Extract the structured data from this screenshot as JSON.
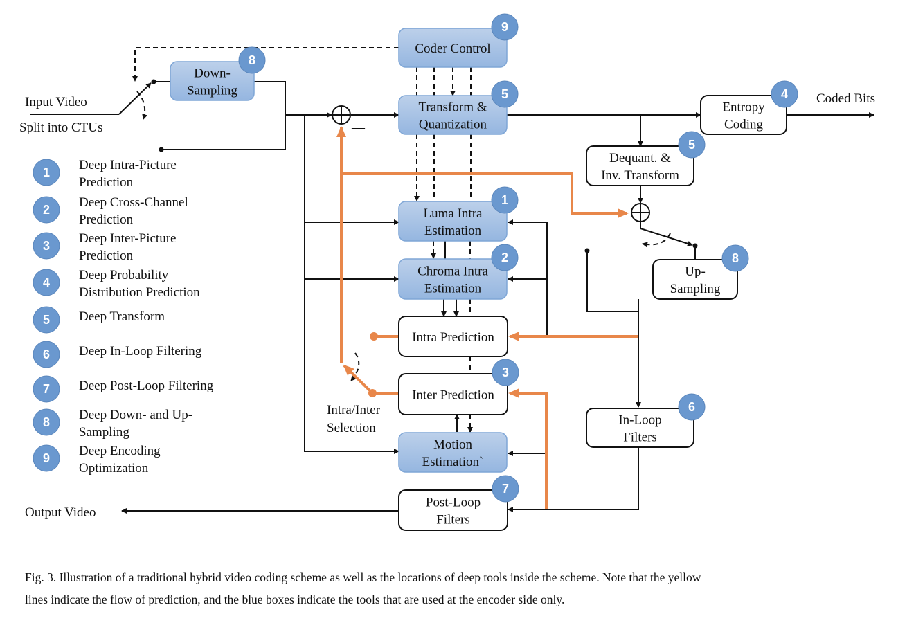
{
  "labels": {
    "input_video": "Input Video",
    "split_ctus": "Split into CTUs",
    "coded_bits": "Coded Bits",
    "output_video": "Output Video",
    "intra_inter_sel_1": "Intra/Inter",
    "intra_inter_sel_2": "Selection",
    "minus_sign": "—"
  },
  "blocks": {
    "coder_control": {
      "lines": [
        "Coder Control"
      ],
      "badge": "9",
      "style": "blue"
    },
    "down_sampling": {
      "lines": [
        "Down-",
        "Sampling"
      ],
      "badge": "8",
      "style": "blue"
    },
    "transform_quant": {
      "lines": [
        "Transform &",
        "Quantization"
      ],
      "badge": "5",
      "style": "blue"
    },
    "entropy_coding": {
      "lines": [
        "Entropy",
        "Coding"
      ],
      "badge": "4",
      "style": "white"
    },
    "dequant_inv": {
      "lines": [
        "Dequant. &",
        "Inv. Transform"
      ],
      "badge": "5",
      "style": "white"
    },
    "luma_intra": {
      "lines": [
        "Luma Intra",
        "Estimation"
      ],
      "badge": "1",
      "style": "blue"
    },
    "chroma_intra": {
      "lines": [
        "Chroma Intra",
        "Estimation"
      ],
      "badge": "2",
      "style": "blue"
    },
    "up_sampling": {
      "lines": [
        "Up-",
        "Sampling"
      ],
      "badge": "8",
      "style": "white"
    },
    "intra_prediction": {
      "lines": [
        "Intra Prediction"
      ],
      "badge": "",
      "style": "white"
    },
    "inter_prediction": {
      "lines": [
        "Inter Prediction"
      ],
      "badge": "3",
      "style": "white"
    },
    "in_loop_filters": {
      "lines": [
        "In-Loop",
        "Filters"
      ],
      "badge": "6",
      "style": "white"
    },
    "motion_estimation": {
      "lines": [
        "Motion",
        "Estimation`"
      ],
      "badge": "",
      "style": "blue"
    },
    "post_loop_filters": {
      "lines": [
        "Post-Loop",
        "Filters"
      ],
      "badge": "7",
      "style": "white"
    }
  },
  "legend": [
    {
      "num": "1",
      "lines": [
        "Deep Intra-Picture",
        "Prediction"
      ]
    },
    {
      "num": "2",
      "lines": [
        "Deep Cross-Channel",
        "Prediction"
      ]
    },
    {
      "num": "3",
      "lines": [
        "Deep Inter-Picture",
        "Prediction"
      ]
    },
    {
      "num": "4",
      "lines": [
        "Deep Probability",
        "Distribution Prediction"
      ]
    },
    {
      "num": "5",
      "lines": [
        "Deep Transform"
      ]
    },
    {
      "num": "6",
      "lines": [
        "Deep In-Loop Filtering"
      ]
    },
    {
      "num": "7",
      "lines": [
        "Deep Post-Loop Filtering"
      ]
    },
    {
      "num": "8",
      "lines": [
        "Deep Down- and Up-",
        "Sampling"
      ]
    },
    {
      "num": "9",
      "lines": [
        "Deep Encoding",
        "Optimization"
      ]
    }
  ],
  "colors": {
    "prediction_flow": "#E8874A",
    "badge": "#6A98CF",
    "encoder_box_top": "#BCD0EA",
    "encoder_box_bottom": "#95B6E0"
  },
  "caption": {
    "line1": "Fig. 3.  Illustration of a traditional hybrid video coding scheme as well as the locations of deep tools inside the scheme. Note that the yellow",
    "line2": "lines indicate the flow of prediction, and the blue boxes indicate the tools that are used at the encoder side only."
  }
}
